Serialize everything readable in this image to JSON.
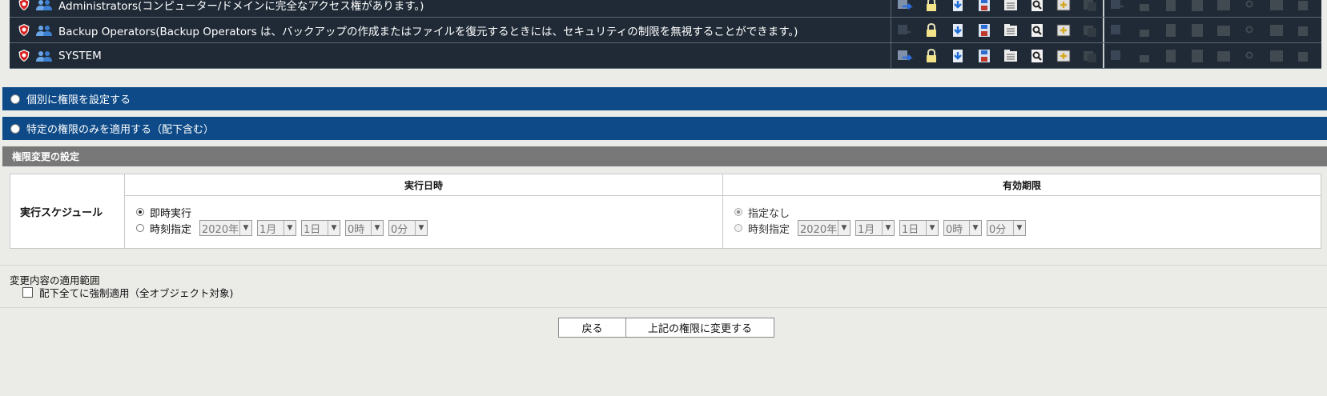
{
  "permission_rows": [
    {
      "label": "Administrators(コンピューター/ドメインに完全なアクセス権があります。)"
    },
    {
      "label": "Backup Operators(Backup Operators は、バックアップの作成またはファイルを復元するときには、セキュリティの制限を無視することができます。)"
    },
    {
      "label": "SYSTEM"
    }
  ],
  "options": {
    "individual_label": "個別に権限を設定する",
    "specific_label": "特定の権限のみを適用する（配下含む）"
  },
  "section": {
    "title": "権限変更の設定"
  },
  "schedule": {
    "row_label": "実行スケジュール",
    "exec_header": "実行日時",
    "expiry_header": "有効期限",
    "exec_immediate": "即時実行",
    "exec_specify": "時刻指定",
    "expiry_none": "指定なし",
    "expiry_specify": "時刻指定",
    "year": "2020年",
    "month": "1月",
    "day": "1日",
    "hour": "0時",
    "minute": "0分"
  },
  "scope": {
    "title": "変更内容の適用範囲",
    "force_label": "配下全てに強制適用（全オブジェクト対象)"
  },
  "buttons": {
    "back": "戻る",
    "apply": "上記の権限に変更する"
  },
  "colors": {
    "row_bg": "#1f2a36",
    "option_bar": "#0d4a87",
    "section_head": "#787878"
  }
}
